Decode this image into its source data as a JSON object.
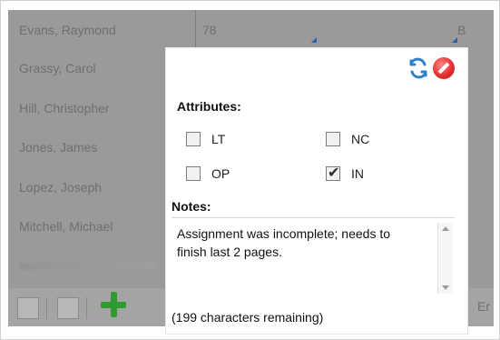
{
  "grid": {
    "names": [
      "Evans, Raymond",
      "Grassy, Carol",
      "Hill, Christopher",
      "Jones, James",
      "Lopez, Joseph",
      "Mitchell, Michael"
    ],
    "row1_score": "78",
    "row1_right_label": "B"
  },
  "footer": {
    "right_text": "Er"
  },
  "popover": {
    "attributes_title": "Attributes:",
    "attributes": {
      "lt": {
        "label": "LT",
        "checked": false
      },
      "nc": {
        "label": "NC",
        "checked": false
      },
      "op": {
        "label": "OP",
        "checked": false
      },
      "in": {
        "label": "IN",
        "checked": true
      }
    },
    "notes_title": "Notes:",
    "notes_text": "Assignment was incomplete; needs to finish last 2 pages.",
    "chars_remaining": "(199 characters remaining)",
    "icons": {
      "refresh": "refresh-icon",
      "cancel": "stop-icon"
    }
  },
  "colors": {
    "overlay_gray": "#9a9a9a",
    "popover_bg": "#ffffff",
    "accent_blue": "#2f5fa6",
    "add_green": "#2f9a2f",
    "cancel_red": "#e53030"
  }
}
